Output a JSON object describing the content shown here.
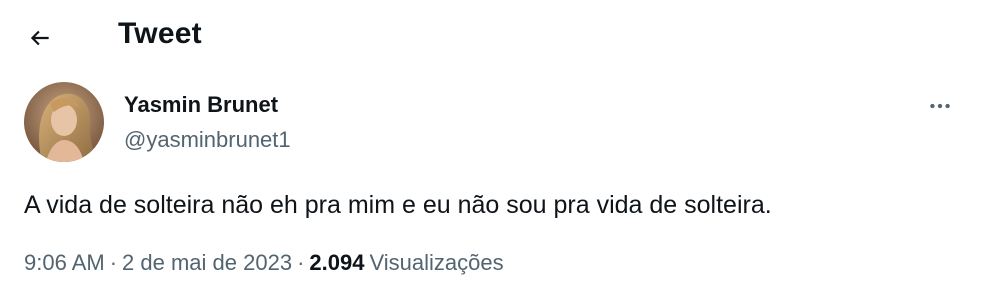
{
  "header": {
    "title": "Tweet",
    "back_icon": "arrow-left-icon"
  },
  "author": {
    "display_name": "Yasmin Brunet",
    "handle": "@yasminbrunet1",
    "avatar_icon": "profile-photo"
  },
  "tweet": {
    "text": "A vida de solteira não eh pra mim e eu não sou pra vida de solteira."
  },
  "meta": {
    "time": "9:06 AM",
    "separator": "·",
    "date": "2 de mai de 2023",
    "views_count": "2.094",
    "views_label": "Visualizações"
  },
  "more_icon": "more-dots-icon",
  "colors": {
    "text_primary": "#0f1419",
    "text_secondary": "#536471",
    "background": "#ffffff"
  }
}
